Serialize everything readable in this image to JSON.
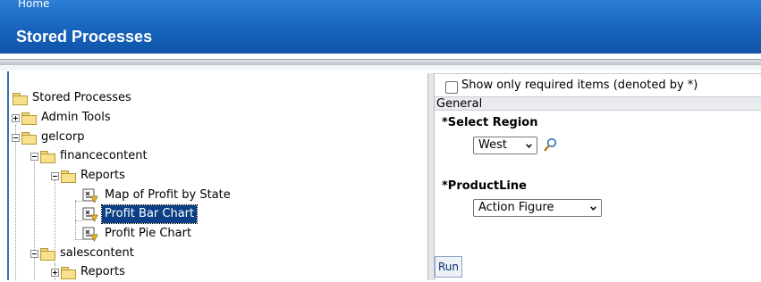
{
  "header": {
    "home_link": "Home",
    "title": "Stored Processes",
    "banner_color": "#1763bc"
  },
  "tree": {
    "root": "Stored Processes",
    "admin_tools": "Admin Tools",
    "gelcorp": "gelcorp",
    "financecontent": "financecontent",
    "reports1": "Reports",
    "item_map": "Map of Profit by State",
    "item_bar": "Profit Bar Chart",
    "item_pie": "Profit Pie Chart",
    "salescontent": "salescontent",
    "reports2": "Reports",
    "selected": "Profit Bar Chart",
    "selection_color": "#0b3f86"
  },
  "params": {
    "required_only_label": "Show only required items (denoted by *)",
    "group": "General",
    "region_label": "*Select Region",
    "region_value": "West",
    "productline_label": "*ProductLine",
    "productline_value": "Action Figure",
    "run_label": "Run"
  }
}
